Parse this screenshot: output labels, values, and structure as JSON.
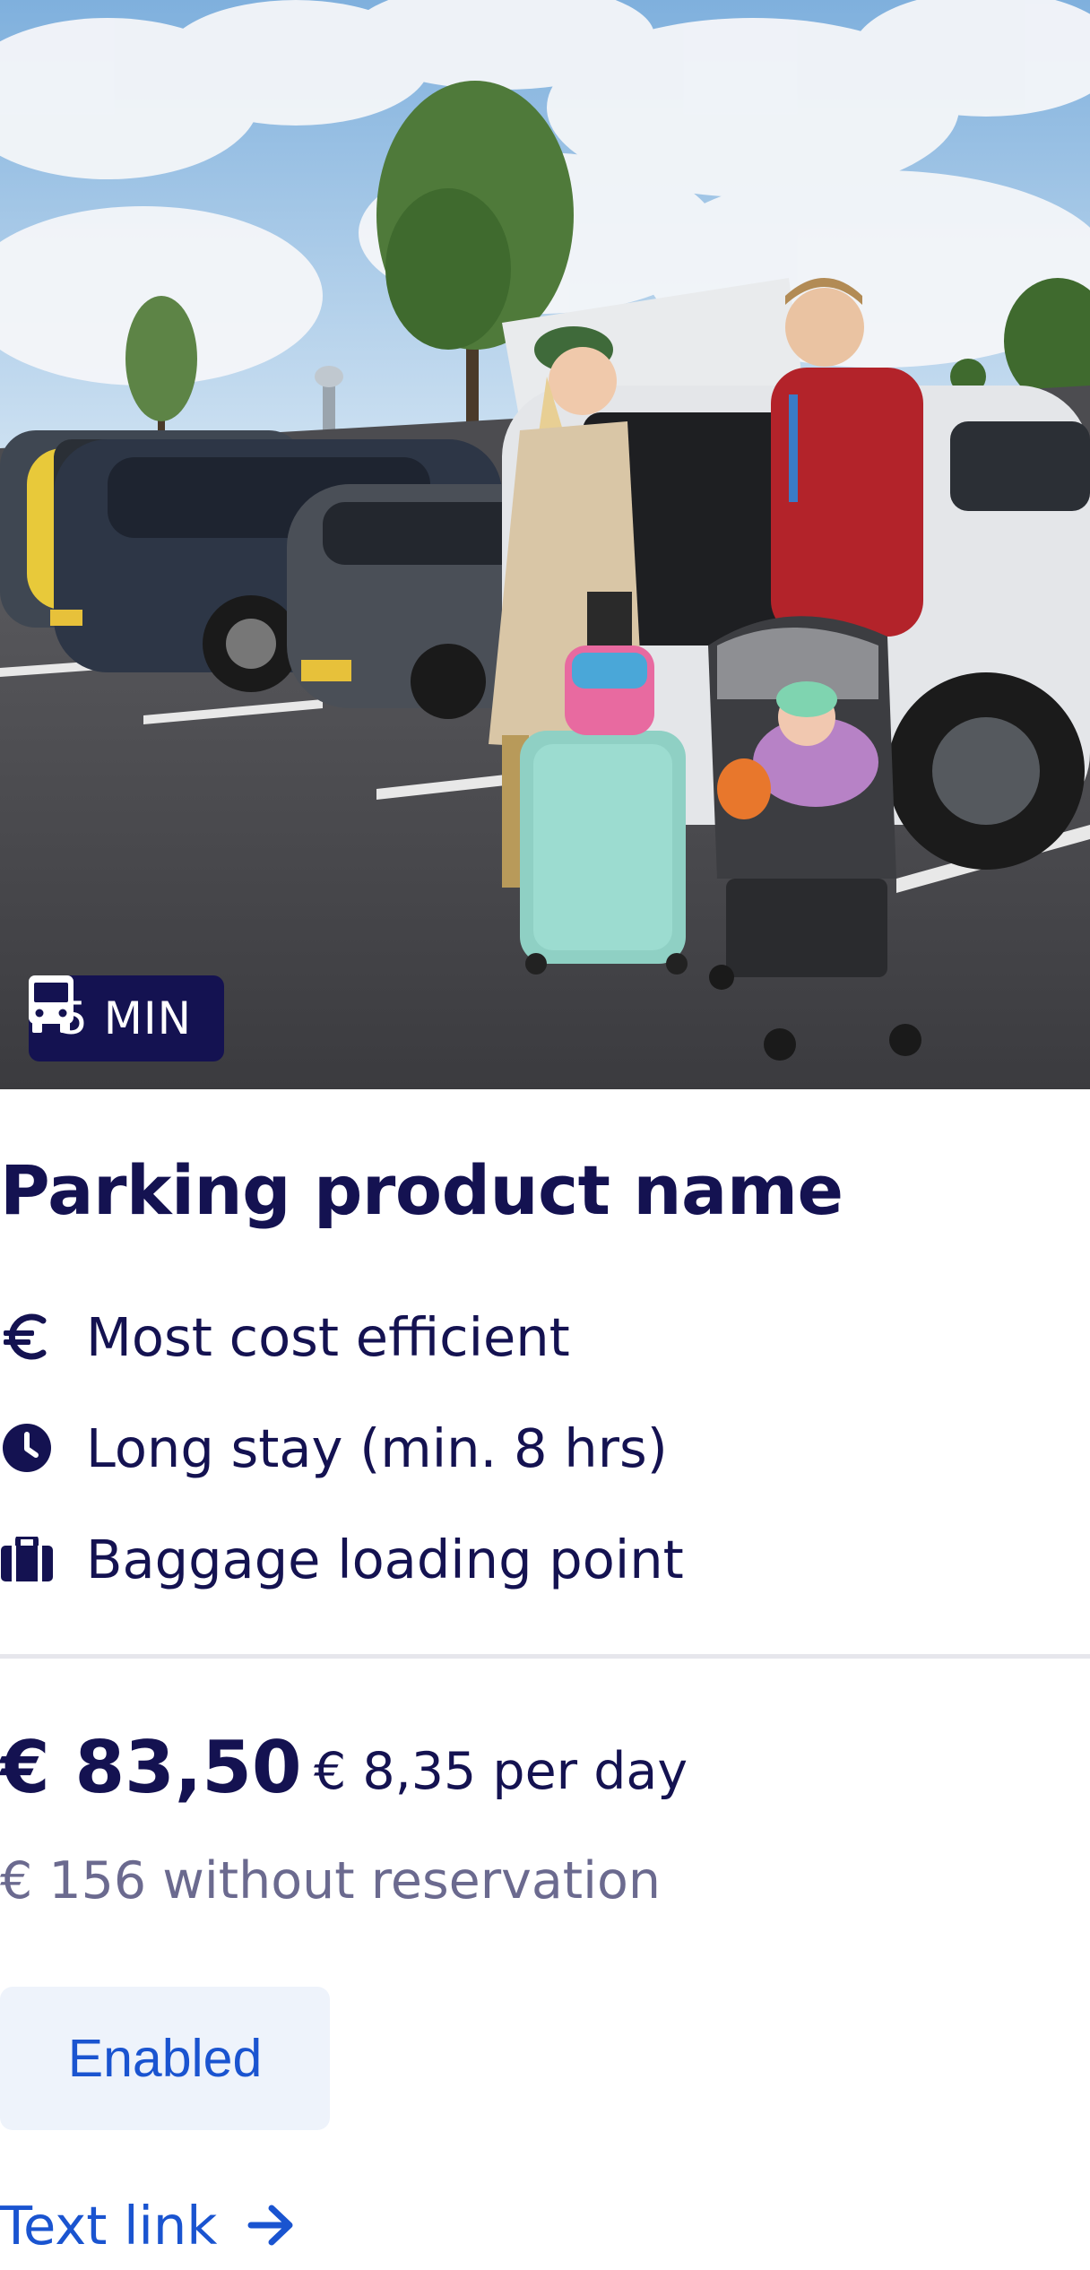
{
  "card": {
    "image": {
      "description_icon": "parking-photo"
    },
    "badge": {
      "icon": "bus-icon",
      "text": "5 MIN"
    },
    "title": "Parking product name",
    "features": [
      {
        "icon": "euro-icon",
        "label": "Most cost efficient"
      },
      {
        "icon": "clock-icon",
        "label": "Long stay (min. 8 hrs)"
      },
      {
        "icon": "briefcase-icon",
        "label": "Baggage loading point"
      }
    ],
    "price": "€ 83,50",
    "per_day": "€ 8,35 per day",
    "without_reservation": "€ 156 without reservation",
    "button_label": "Enabled",
    "link_label": "Text link",
    "link_icon": "arrow-right-icon"
  },
  "colors": {
    "navy": "#141251",
    "link_blue": "#1a54d0",
    "button_bg": "#eef3fb",
    "muted_text": "#6b6a8f",
    "divider": "#e6e6ec"
  }
}
